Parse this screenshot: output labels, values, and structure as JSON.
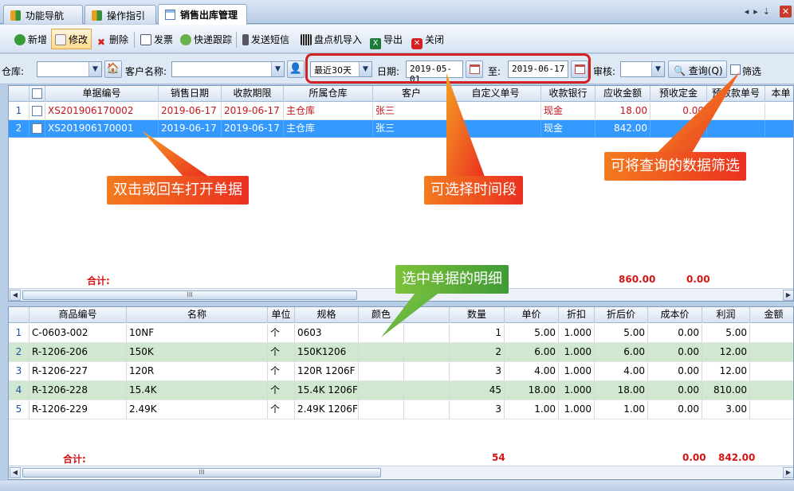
{
  "tabs": [
    {
      "label": "功能导航",
      "icon": "grid-icon"
    },
    {
      "label": "操作指引",
      "icon": "grid-icon"
    },
    {
      "label": "销售出库管理",
      "icon": "document-icon",
      "active": true
    }
  ],
  "toolbar": {
    "new": "新增",
    "edit": "修改",
    "delete": "删除",
    "invoice": "发票",
    "tracking": "快递跟踪",
    "sms": "发送短信",
    "import": "盘点机导入",
    "export": "导出",
    "close": "关闭"
  },
  "filter": {
    "warehouse_label": "仓库:",
    "customer_label": "客户名称:",
    "period_value": "最近30天",
    "date_label": "日期:",
    "date_from": "2019-05-01",
    "to_label": "至:",
    "date_to": "2019-06-17",
    "audit_label": "审核:",
    "query_label": "查询(Q)",
    "filter_label": "筛选"
  },
  "orders": {
    "headers": [
      "单据编号",
      "销售日期",
      "收款期限",
      "所属仓库",
      "客户",
      "自定义单号",
      "收款银行",
      "应收金额",
      "预收定金",
      "预收款单号",
      "本单"
    ],
    "rows": [
      {
        "n": "1",
        "id": "XS201906170002",
        "date": "2019-06-17",
        "due": "2019-06-17",
        "wh": "主仓库",
        "cust": "张三",
        "custom": "",
        "bank": "现金",
        "amount": "18.00",
        "deposit": "0.00"
      },
      {
        "n": "2",
        "id": "XS201906170001",
        "date": "2019-06-17",
        "due": "2019-06-17",
        "wh": "主仓库",
        "cust": "张三",
        "custom": "",
        "bank": "现金",
        "amount": "842.00",
        "deposit": ""
      }
    ],
    "total_label": "合计:",
    "total_amount": "860.00",
    "total_deposit": "0.00"
  },
  "details": {
    "headers": [
      "商品编号",
      "名称",
      "单位",
      "规格",
      "颜色",
      "",
      "数量",
      "单价",
      "折扣",
      "折后价",
      "成本价",
      "利润",
      "金额"
    ],
    "rows": [
      {
        "n": "1",
        "code": "C-0603-002",
        "name": "10NF",
        "unit": "个",
        "spec": "0603",
        "qty": "1",
        "price": "5.00",
        "disc": "1.000",
        "net": "5.00",
        "cost": "0.00",
        "profit": "5.00"
      },
      {
        "n": "2",
        "code": "R-1206-206",
        "name": "150K",
        "unit": "个",
        "spec": "150K1206",
        "qty": "2",
        "price": "6.00",
        "disc": "1.000",
        "net": "6.00",
        "cost": "0.00",
        "profit": "12.00"
      },
      {
        "n": "3",
        "code": "R-1206-227",
        "name": "120R",
        "unit": "个",
        "spec": "120R 1206F",
        "qty": "3",
        "price": "4.00",
        "disc": "1.000",
        "net": "4.00",
        "cost": "0.00",
        "profit": "12.00"
      },
      {
        "n": "4",
        "code": "R-1206-228",
        "name": "15.4K",
        "unit": "个",
        "spec": "15.4K 1206F",
        "qty": "45",
        "price": "18.00",
        "disc": "1.000",
        "net": "18.00",
        "cost": "0.00",
        "profit": "810.00"
      },
      {
        "n": "5",
        "code": "R-1206-229",
        "name": "2.49K",
        "unit": "个",
        "spec": "2.49K 1206F",
        "qty": "3",
        "price": "1.00",
        "disc": "1.000",
        "net": "1.00",
        "cost": "0.00",
        "profit": "3.00"
      }
    ],
    "total_label": "合计:",
    "total_qty": "54",
    "total_cost": "0.00",
    "total_profit": "842.00"
  },
  "callouts": {
    "open": "双击或回车打开单据",
    "period": "可选择时间段",
    "filter": "可将查询的数据筛选",
    "detail": "选中单据的明细"
  },
  "scroll_glyph": "III",
  "colors": {
    "selection": "#3399ff",
    "green_row": "#cfe8cf",
    "total_red": "#d41414",
    "callout_red": "#ea3020",
    "callout_green": "#3f9b36"
  }
}
